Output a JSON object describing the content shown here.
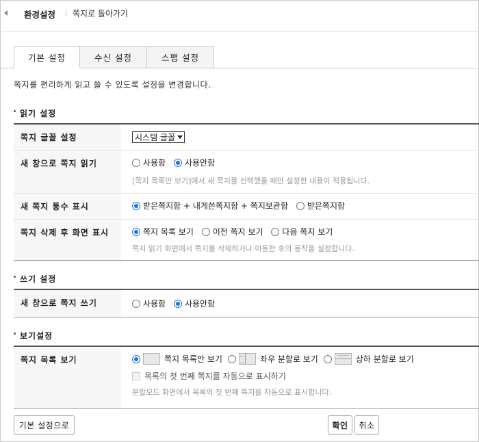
{
  "topbar": {
    "title": "환경설정",
    "back_link": "쪽지로 돌아가기"
  },
  "tabs": [
    {
      "label": "기본 설정",
      "active": true
    },
    {
      "label": "수신 설정",
      "active": false
    },
    {
      "label": "스팸 설정",
      "active": false
    }
  ],
  "description": "쪽지를 편리하게 읽고 쓸 수 있도록 설정을 변경합니다.",
  "read_section": {
    "title": "읽기 설정",
    "font": {
      "label": "쪽지 글꼴 설정",
      "value": "시스템 글꼴"
    },
    "new_window_read": {
      "label": "새 창으로 쪽지 읽기",
      "opt_on": "사용함",
      "opt_off": "사용안함",
      "selected": "사용안함",
      "hint": "[쪽지 목록만 보기]에서 새 쪽지를 선택했을 때만 설정한 내용이 적용됩니다."
    },
    "count_display": {
      "label": "새 쪽지 통수 표시",
      "opt_all": "받은쪽지함 + 내게쓴쪽지함 + 쪽지보관함",
      "opt_inbox": "받은쪽지함",
      "selected": "받은쪽지함 + 내게쓴쪽지함 + 쪽지보관함"
    },
    "after_delete": {
      "label": "쪽지 삭제 후 화면 표시",
      "opt_list": "쪽지 목록 보기",
      "opt_prev": "이전 쪽지 보기",
      "opt_next": "다음 쪽지 보기",
      "selected": "쪽지 목록 보기",
      "hint": "쪽지 읽기 화면에서 쪽지를 삭제하거나 이동한 후의 동작을 설정합니다."
    }
  },
  "write_section": {
    "title": "쓰기 설정",
    "new_window_write": {
      "label": "새 창으로 쪽지 쓰기",
      "opt_on": "사용함",
      "opt_off": "사용안함",
      "selected": "사용안함"
    }
  },
  "view_section": {
    "title": "보기설정",
    "list_view": {
      "label": "쪽지 목록 보기",
      "opt_list": "쪽지 목록만 보기",
      "opt_lr": "좌우 분할로 보기",
      "opt_tb": "상하 분할로 보기",
      "selected": "쪽지 목록만 보기",
      "checkbox_label": "목록의 첫 번째 쪽지를 자동으로 표시하기",
      "hint": "분할모드 화면에서 목록의 첫 번째 쪽지를 자동으로 표시합니다."
    }
  },
  "buttons": {
    "reset": "기본 설정으로",
    "confirm": "확인",
    "cancel": "취소"
  },
  "colors": {
    "accent": "#1a73e8",
    "border": "#c9c9c9",
    "header_bg": "#f7f7f7"
  }
}
